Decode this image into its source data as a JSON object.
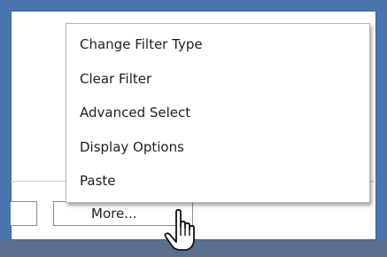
{
  "context_menu": {
    "items": [
      {
        "label": "Change Filter Type"
      },
      {
        "label": "Clear Filter"
      },
      {
        "label": "Advanced Select"
      },
      {
        "label": "Display Options"
      },
      {
        "label": "Paste"
      }
    ]
  },
  "toolbar": {
    "more_label": "More..."
  },
  "cursor": {
    "icon": "hand-pointer-icon"
  },
  "colors": {
    "frame": "#4a76b0",
    "panel": "#ffffff",
    "menu_border": "#b5b5b5"
  }
}
